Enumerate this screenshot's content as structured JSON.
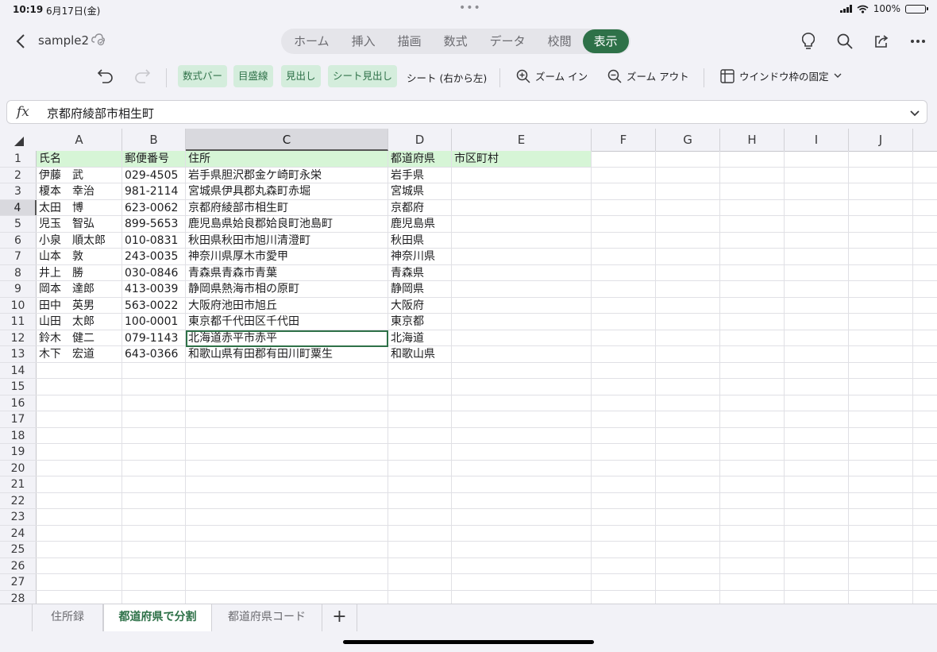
{
  "status": {
    "time": "10:19",
    "date": "6月17日(金)",
    "battery": "100%"
  },
  "file": {
    "name": "sample2"
  },
  "tabs": [
    {
      "label": "ホーム"
    },
    {
      "label": "挿入"
    },
    {
      "label": "描画"
    },
    {
      "label": "数式"
    },
    {
      "label": "データ"
    },
    {
      "label": "校閲"
    },
    {
      "label": "表示",
      "active": true
    }
  ],
  "ribbon": {
    "formula_bar": "数式バー",
    "gridlines": "目盛線",
    "headings": "見出し",
    "sheet_headings": "シート見出し",
    "sheet_rtl": "シート (右から左)",
    "zoom_in": "ズーム イン",
    "zoom_out": "ズーム アウト",
    "freeze": "ウインドウ枠の固定"
  },
  "formula": {
    "fx": "fx",
    "value": "京都府綾部市相生町"
  },
  "columns": [
    {
      "label": "A"
    },
    {
      "label": "B"
    },
    {
      "label": "C",
      "selected": true
    },
    {
      "label": "D"
    },
    {
      "label": "E"
    },
    {
      "label": "F"
    },
    {
      "label": "G"
    },
    {
      "label": "H"
    },
    {
      "label": "I"
    },
    {
      "label": "J"
    }
  ],
  "selection": {
    "row": 4,
    "column": "C"
  },
  "rows": [
    [
      "氏名",
      "郵便番号",
      "住所",
      "都道府県",
      "市区町村"
    ],
    [
      "伊藤　武",
      "029-4505",
      "岩手県胆沢郡金ケ崎町永栄",
      "岩手県",
      ""
    ],
    [
      "榎本　幸治",
      "981-2114",
      "宮城県伊具郡丸森町赤堀",
      "宮城県",
      ""
    ],
    [
      "太田　博",
      "623-0062",
      "京都府綾部市相生町",
      "京都府",
      ""
    ],
    [
      "児玉　智弘",
      "899-5653",
      "鹿児島県姶良郡姶良町池島町",
      "鹿児島県",
      ""
    ],
    [
      "小泉　順太郎",
      "010-0831",
      "秋田県秋田市旭川清澄町",
      "秋田県",
      ""
    ],
    [
      "山本　敦",
      "243-0035",
      "神奈川県厚木市愛甲",
      "神奈川県",
      ""
    ],
    [
      "井上　勝",
      "030-0846",
      "青森県青森市青葉",
      "青森県",
      ""
    ],
    [
      "岡本　達郎",
      "413-0039",
      "静岡県熱海市相の原町",
      "静岡県",
      ""
    ],
    [
      "田中　英男",
      "563-0022",
      "大阪府池田市旭丘",
      "大阪府",
      ""
    ],
    [
      "山田　太郎",
      "100-0001",
      "東京都千代田区千代田",
      "東京都",
      ""
    ],
    [
      "鈴木　健二",
      "079-1143",
      "北海道赤平市赤平",
      "北海道",
      ""
    ],
    [
      "木下　宏道",
      "643-0366",
      "和歌山県有田郡有田川町粟生",
      "和歌山県",
      ""
    ],
    [
      "",
      "",
      "",
      "",
      ""
    ],
    [
      "",
      "",
      "",
      "",
      ""
    ],
    [
      "",
      "",
      "",
      "",
      ""
    ],
    [
      "",
      "",
      "",
      "",
      ""
    ],
    [
      "",
      "",
      "",
      "",
      ""
    ],
    [
      "",
      "",
      "",
      "",
      ""
    ],
    [
      "",
      "",
      "",
      "",
      ""
    ],
    [
      "",
      "",
      "",
      "",
      ""
    ],
    [
      "",
      "",
      "",
      "",
      ""
    ],
    [
      "",
      "",
      "",
      "",
      ""
    ],
    [
      "",
      "",
      "",
      "",
      ""
    ],
    [
      "",
      "",
      "",
      "",
      ""
    ],
    [
      "",
      "",
      "",
      "",
      ""
    ],
    [
      "",
      "",
      "",
      "",
      ""
    ],
    [
      "",
      "",
      "",
      "",
      ""
    ]
  ],
  "sheets": [
    {
      "label": "住所録"
    },
    {
      "label": "都道府県で分割",
      "active": true
    },
    {
      "label": "都道府県コード"
    }
  ],
  "add_sheet": "+"
}
